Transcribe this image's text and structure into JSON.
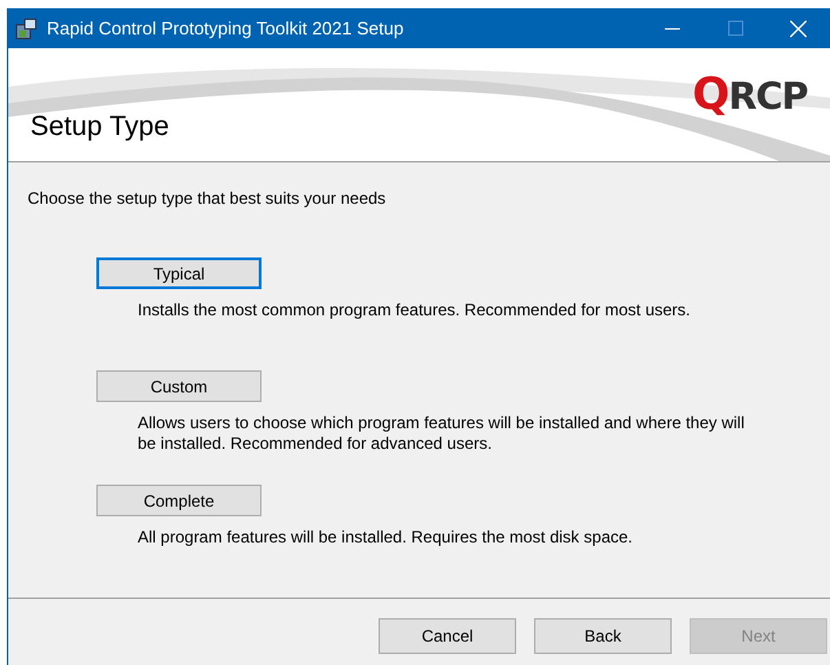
{
  "window": {
    "title": "Rapid Control Prototyping Toolkit 2021 Setup"
  },
  "logo": {
    "mark": "Q",
    "text": "RCP"
  },
  "banner": {
    "title": "Setup Type"
  },
  "intro": "Choose the setup type that best suits your needs",
  "options": [
    {
      "label": "Typical",
      "focused": true,
      "description": "Installs the most common program features. Recommended for most users."
    },
    {
      "label": "Custom",
      "focused": false,
      "description": "Allows users to choose which program features will be installed and where they will be installed. Recommended for advanced users."
    },
    {
      "label": "Complete",
      "focused": false,
      "description": "All program features will be installed. Requires the most disk space."
    }
  ],
  "buttons": [
    {
      "label": "Cancel",
      "disabled": false
    },
    {
      "label": "Back",
      "disabled": false
    },
    {
      "label": "Next",
      "disabled": true
    }
  ]
}
